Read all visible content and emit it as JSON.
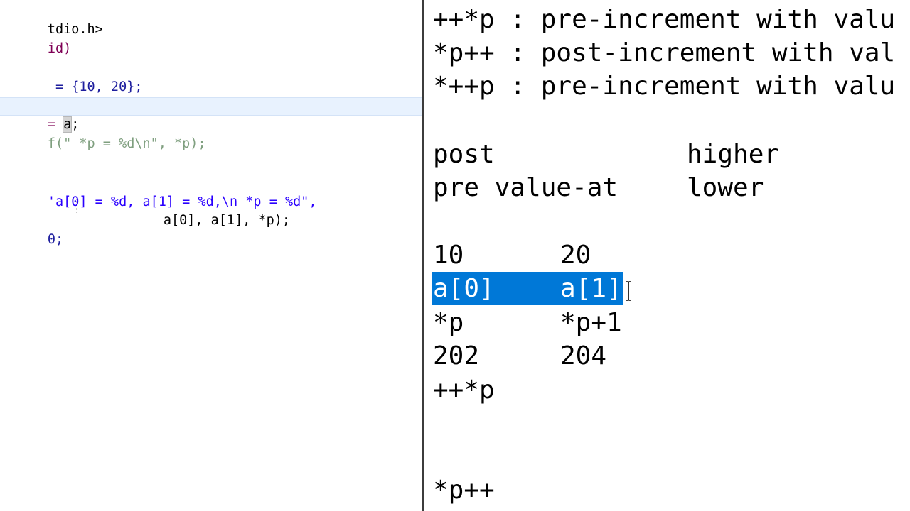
{
  "editor": {
    "lines": [
      {
        "id": "include",
        "text": "tdio.h>"
      },
      {
        "id": "main-sig",
        "text": "id)"
      },
      {
        "id": "array-decl",
        "text": " = {10, 20};"
      },
      {
        "id": "pointer-assign-eq",
        "text": "= "
      },
      {
        "id": "pointer-assign-a",
        "text": "a"
      },
      {
        "id": "pointer-assign-semi",
        "text": ";"
      },
      {
        "id": "commented-printf",
        "text": "f(\" *p = %d\\n\", *p);"
      },
      {
        "id": "printf-line1",
        "text": "'a[0] = %d, a[1] = %d,\\n *p = %d\","
      },
      {
        "id": "printf-line2",
        "text": "a[0], a[1], *p);"
      },
      {
        "id": "return-line",
        "text": "0;"
      }
    ]
  },
  "notes": {
    "line1": "++*p : pre-increment with valu",
    "line2": "*p++ : post-increment with val",
    "line3": "*++p : pre-increment with valu",
    "precedence": {
      "post_label": "post",
      "post_level": "higher",
      "pre_label": "pre value-at",
      "pre_level": "lower"
    },
    "table": {
      "val_a0": "10",
      "val_a1": "20",
      "name_a0": "a[0]",
      "name_a1": "a[1]",
      "ptr_a0": "*p",
      "ptr_a1": "*p+1",
      "addr_a0": "202",
      "addr_a1": "204"
    },
    "expr1": "++*p",
    "expr2": "*p++"
  },
  "colors": {
    "selection": "#0078d7",
    "current_line": "#e8f2fe",
    "divider": "#3c3c3c"
  }
}
